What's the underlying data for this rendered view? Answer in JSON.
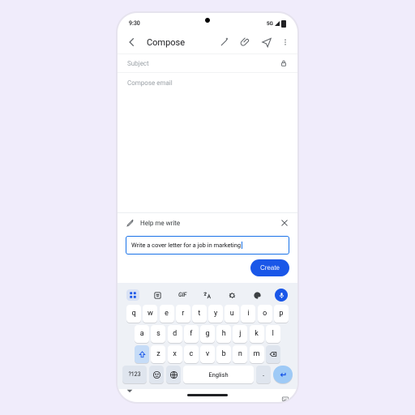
{
  "status": {
    "time": "9:30",
    "network": "5G"
  },
  "appbar": {
    "title": "Compose"
  },
  "compose": {
    "subject_placeholder": "Subject",
    "body_placeholder": "Compose email"
  },
  "hmw": {
    "title": "Help me write",
    "prompt": "Write a cover letter for a job in marketing",
    "create_label": "Create"
  },
  "keyboard": {
    "row1": [
      "q",
      "w",
      "e",
      "r",
      "t",
      "y",
      "u",
      "i",
      "o",
      "p"
    ],
    "row2": [
      "a",
      "s",
      "d",
      "f",
      "g",
      "h",
      "j",
      "k",
      "l"
    ],
    "row3": [
      "z",
      "x",
      "c",
      "v",
      "b",
      "n",
      "m"
    ],
    "symbols_label": "?123",
    "space_label": "English",
    "gif_label": "GIF"
  }
}
